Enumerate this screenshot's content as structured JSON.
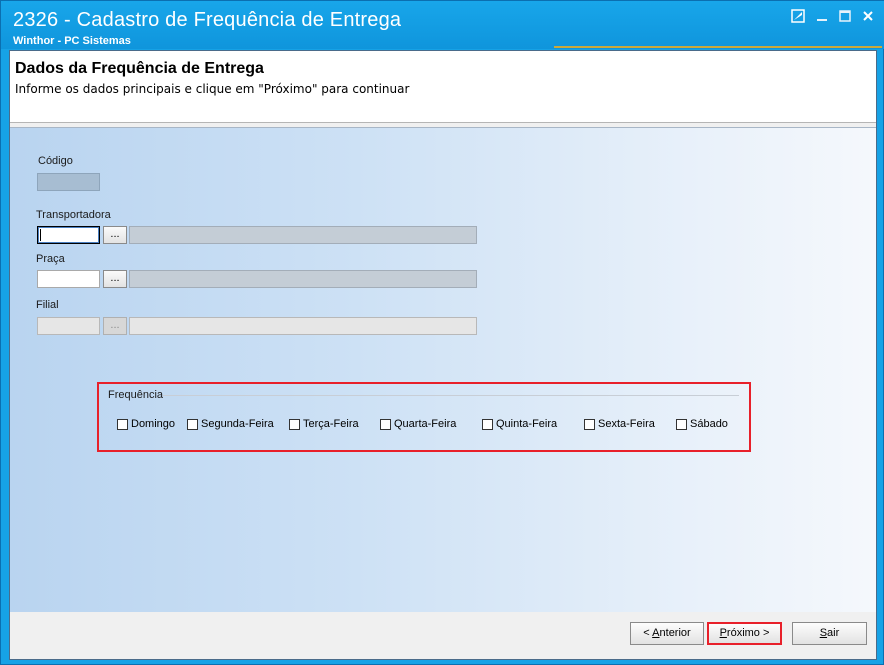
{
  "window": {
    "title": "2326 - Cadastro de Frequência de Entrega",
    "subtitle": "Winthor - PC Sistemas",
    "controls": [
      "edit-icon",
      "minimize-icon",
      "maximize-icon",
      "close-icon"
    ]
  },
  "header": {
    "title": "Dados da Frequência de Entrega",
    "subtitle": "Informe os dados principais e clique em \"Próximo\" para continuar"
  },
  "form": {
    "codigo": {
      "label": "Código",
      "value": ""
    },
    "transportadora": {
      "label": "Transportadora",
      "value": "",
      "button": "...",
      "description": ""
    },
    "praca": {
      "label": "Praça",
      "value": "",
      "button": "...",
      "description": ""
    },
    "filial": {
      "label": "Filial",
      "value": "",
      "button": "...",
      "description": ""
    }
  },
  "frequencia": {
    "title": "Frequência",
    "days": [
      {
        "label": "Domingo",
        "checked": false
      },
      {
        "label": "Segunda-Feira",
        "checked": false
      },
      {
        "label": "Terça-Feira",
        "checked": false
      },
      {
        "label": "Quarta-Feira",
        "checked": false
      },
      {
        "label": "Quinta-Feira",
        "checked": false
      },
      {
        "label": "Sexta-Feira",
        "checked": false
      },
      {
        "label": "Sábado",
        "checked": false
      }
    ]
  },
  "footer": {
    "anterior": {
      "prefix": "< ",
      "mnemonic": "A",
      "rest": "nterior"
    },
    "proximo": {
      "mnemonic": "P",
      "rest": "róximo >"
    },
    "sair": {
      "mnemonic": "S",
      "rest": "air"
    }
  },
  "colors": {
    "title_bar": "#16a2e6",
    "highlight": "#e8202a"
  }
}
